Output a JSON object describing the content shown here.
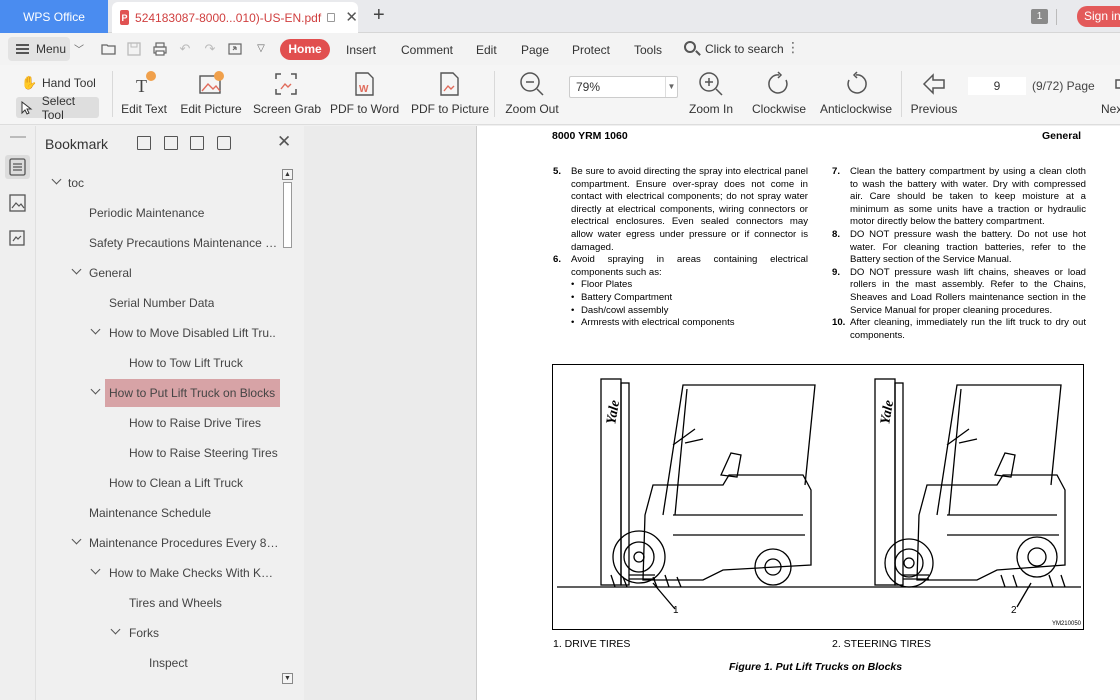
{
  "tabbar": {
    "app_label": "WPS Office",
    "doc_tab_title": "524183087-8000...010)-US-EN.pdf",
    "window_count": "1",
    "sign_in": "Sign in"
  },
  "menubar": {
    "menu_label": "Menu",
    "tabs": [
      "Home",
      "Insert",
      "Comment",
      "Edit",
      "Page",
      "Protect",
      "Tools"
    ],
    "search_label": "Click to search"
  },
  "toolbar": {
    "hand_tool": "Hand Tool",
    "select_tool": "Select Tool",
    "tools": [
      "Edit Text",
      "Edit Picture",
      "Screen Grab",
      "PDF to Word",
      "PDF to Picture",
      "Zoom Out",
      "Zoom In",
      "Clockwise",
      "Anticlockwise",
      "Previous",
      "Next"
    ],
    "zoom_value": "79%",
    "page_value": "9",
    "page_total": "(9/72) Page"
  },
  "bookmark": {
    "title": "Bookmark",
    "items": [
      {
        "label": "toc",
        "expanded": true
      },
      {
        "label": "Periodic Maintenance"
      },
      {
        "label": "Safety Precautions Maintenance a..."
      },
      {
        "label": "General",
        "expanded": true
      },
      {
        "label": "Serial Number Data"
      },
      {
        "label": "How to Move Disabled Lift Tru..",
        "expanded": true
      },
      {
        "label": "How to Tow Lift Truck"
      },
      {
        "label": "How to Put Lift Truck on Blocks",
        "expanded": true,
        "selected": true
      },
      {
        "label": "How to Raise Drive Tires"
      },
      {
        "label": "How to Raise Steering Tires"
      },
      {
        "label": "How to Clean a Lift Truck"
      },
      {
        "label": "Maintenance Schedule"
      },
      {
        "label": "Maintenance Procedures Every 8 ...",
        "expanded": true
      },
      {
        "label": "How to Make Checks With Key..",
        "expanded": true
      },
      {
        "label": "Tires and Wheels"
      },
      {
        "label": "Forks",
        "expanded": true
      },
      {
        "label": "Inspect"
      }
    ]
  },
  "document": {
    "header_left": "8000 YRM 1060",
    "header_right": "General",
    "left_items": [
      {
        "num": "5.",
        "text": "Be sure to avoid directing the spray into electrical panel compartment. Ensure over-spray does not come in contact with electrical components; do not spray water directly at electrical components, wiring connectors or electrical enclosures. Even sealed connectors may allow water egress under pressure or if connector is damaged."
      },
      {
        "num": "6.",
        "text": "Avoid spraying in areas containing electrical components such as:"
      }
    ],
    "bullets": [
      "Floor Plates",
      "Battery Compartment",
      "Dash/cowl assembly",
      "Armrests with electrical components"
    ],
    "right_items": [
      {
        "num": "7.",
        "text": "Clean the battery compartment by using a clean cloth to wash the battery with water. Dry with compressed air. Care should be taken to keep moisture at a minimum as some units have a traction or hydraulic motor directly below the battery compartment."
      },
      {
        "num": "8.",
        "text": "DO NOT pressure wash the battery. Do not use hot water. For cleaning traction batteries, refer to the Battery section of the Service Manual."
      },
      {
        "num": "9.",
        "text": "DO NOT pressure wash lift chains, sheaves or load rollers in the mast assembly. Refer to the Chains, Sheaves and Load Rollers maintenance section in the Service Manual for proper cleaning procedures."
      },
      {
        "num": "10.",
        "text": "After cleaning, immediately run the lift truck to dry out components."
      }
    ],
    "figure_code": "YM210050",
    "brand": "Yale",
    "callouts": [
      "1",
      "2"
    ],
    "captions": [
      "1.   DRIVE TIRES",
      "2.   STEERING TIRES"
    ],
    "figure_caption": "Figure 1. Put Lift Trucks on Blocks"
  }
}
